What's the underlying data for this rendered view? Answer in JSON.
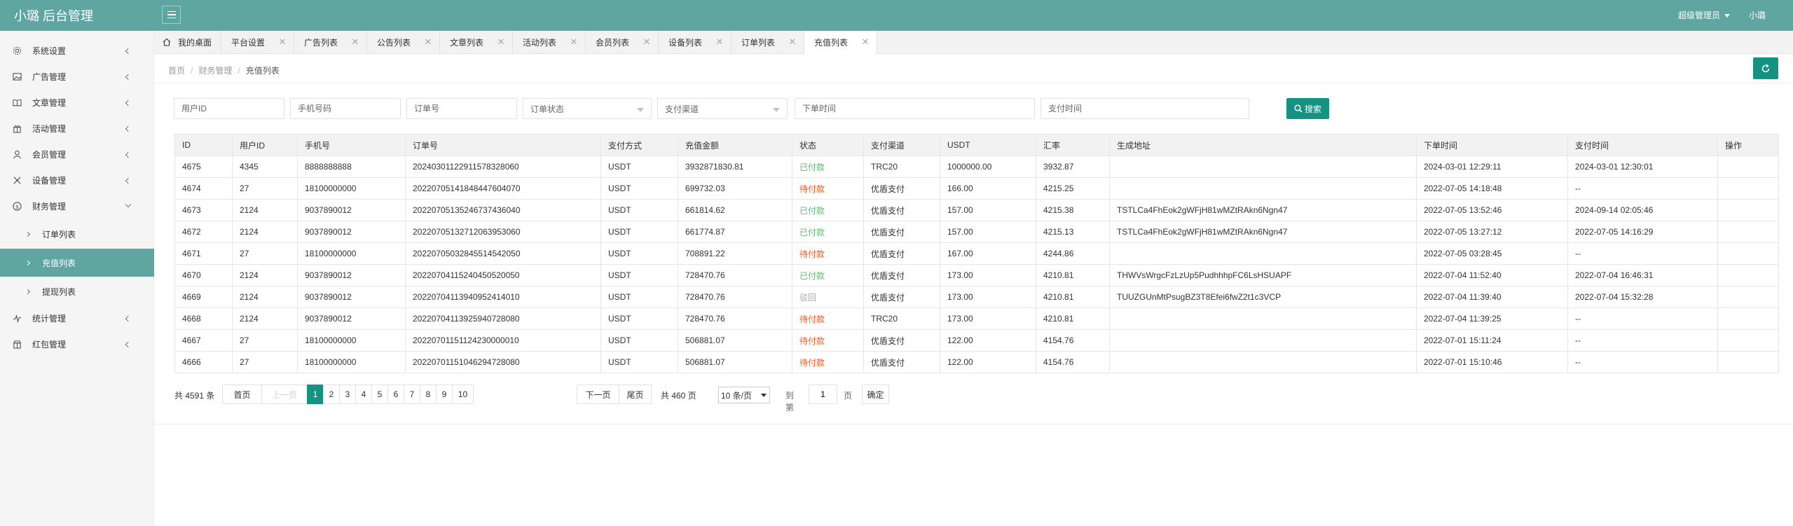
{
  "header": {
    "logo": "小璐 后台管理",
    "role": "超级管理员",
    "user": "小璐"
  },
  "sidebar": {
    "items": [
      {
        "label": "系统设置",
        "icon": "gear-icon"
      },
      {
        "label": "广告管理",
        "icon": "image-icon"
      },
      {
        "label": "文章管理",
        "icon": "book-icon"
      },
      {
        "label": "活动管理",
        "icon": "gift-icon"
      },
      {
        "label": "会员管理",
        "icon": "user-icon"
      },
      {
        "label": "设备管理",
        "icon": "device-icon"
      },
      {
        "label": "财务管理",
        "icon": "money-icon"
      }
    ],
    "finance_sub": [
      {
        "label": "订单列表"
      },
      {
        "label": "充值列表"
      },
      {
        "label": "提现列表"
      }
    ],
    "items_after": [
      {
        "label": "统计管理",
        "icon": "chart-icon"
      },
      {
        "label": "红包管理",
        "icon": "redpacket-icon"
      }
    ]
  },
  "tabs": [
    {
      "label": "我的桌面"
    },
    {
      "label": "平台设置"
    },
    {
      "label": "广告列表"
    },
    {
      "label": "公告列表"
    },
    {
      "label": "文章列表"
    },
    {
      "label": "活动列表"
    },
    {
      "label": "会员列表"
    },
    {
      "label": "设备列表"
    },
    {
      "label": "订单列表"
    },
    {
      "label": "充值列表"
    }
  ],
  "breadcrumb": {
    "home": "首页",
    "section": "财务管理",
    "current": "充值列表"
  },
  "filters": {
    "user_id": "用户ID",
    "phone": "手机号码",
    "order_no": "订单号",
    "order_status": "订单状态",
    "pay_channel": "支付渠道",
    "order_time": "下单时间",
    "pay_time": "支付时间",
    "search": "搜索"
  },
  "table": {
    "headers": [
      "ID",
      "用户ID",
      "手机号",
      "订单号",
      "支付方式",
      "充值金额",
      "状态",
      "支付渠道",
      "USDT",
      "汇率",
      "生成地址",
      "下单时间",
      "支付时间",
      "操作"
    ],
    "rows": [
      [
        "4675",
        "4345",
        "8888888888",
        "202403011229115783280​60",
        "USDT",
        "3932871830.81",
        "已付款",
        "TRC20",
        "1000000.00",
        "3932.87",
        "",
        "2024-03-01 12:29:11",
        "2024-03-01 12:30:01",
        ""
      ],
      [
        "4674",
        "27",
        "18100000000",
        "20220705141848447604070",
        "USDT",
        "699732.03",
        "待付款",
        "优盾支付",
        "166.00",
        "4215.25",
        "",
        "2022-07-05 14:18:48",
        "--",
        ""
      ],
      [
        "4673",
        "2124",
        "9037890012",
        "20220705135246737436040",
        "USDT",
        "661814.62",
        "已付款",
        "优盾支付",
        "157.00",
        "4215.38",
        "TSTLCa4FhEok2gWFjH81wMZtRAkn6Ngn47",
        "2022-07-05 13:52:46",
        "2024-09-14 02:05:46",
        ""
      ],
      [
        "4672",
        "2124",
        "9037890012",
        "20220705132712063953060",
        "USDT",
        "661774.87",
        "已付款",
        "优盾支付",
        "157.00",
        "4215.13",
        "TSTLCa4FhEok2gWFjH81wMZtRAkn6Ngn47",
        "2022-07-05 13:27:12",
        "2022-07-05 14:16:29",
        ""
      ],
      [
        "4671",
        "27",
        "18100000000",
        "20220705032845514542050",
        "USDT",
        "708891.22",
        "待付款",
        "优盾支付",
        "167.00",
        "4244.86",
        "",
        "2022-07-05 03:28:45",
        "--",
        ""
      ],
      [
        "4670",
        "2124",
        "9037890012",
        "20220704115240450520050",
        "USDT",
        "728470.76",
        "已付款",
        "优盾支付",
        "173.00",
        "4210.81",
        "THWVsWrgcFzLzUp5PudhhhpFC6LsHSUAPF",
        "2022-07-04 11:52:40",
        "2022-07-04 16:46:31",
        ""
      ],
      [
        "4669",
        "2124",
        "9037890012",
        "20220704113940952414010",
        "USDT",
        "728470.76",
        "驳回",
        "优盾支付",
        "173.00",
        "4210.81",
        "TUUZGUnMtPsugBZ3T8Efei6fwZ2t1c3VCP",
        "2022-07-04 11:39:40",
        "2022-07-04 15:32:28",
        ""
      ],
      [
        "4668",
        "2124",
        "9037890012",
        "20220704113925940728080",
        "USDT",
        "728470.76",
        "待付款",
        "TRC20",
        "173.00",
        "4210.81",
        "",
        "2022-07-04 11:39:25",
        "--",
        ""
      ],
      [
        "4667",
        "27",
        "18100000000",
        "20220701151124230000010",
        "USDT",
        "506881.07",
        "待付款",
        "优盾支付",
        "122.00",
        "4154.76",
        "",
        "2022-07-01 15:11:24",
        "--",
        ""
      ],
      [
        "4666",
        "27",
        "18100000000",
        "20220701151046294728080",
        "USDT",
        "506881.07",
        "待付款",
        "优盾支付",
        "122.00",
        "4154.76",
        "",
        "2022-07-01 15:10:46",
        "--",
        ""
      ]
    ]
  },
  "status_colors": {
    "已付款": "#5fb878",
    "待付款": "#ff5722",
    "驳回": "#aaaaaa"
  },
  "accent_color": "#149383",
  "header_color": "#5fa6a0",
  "pager": {
    "total": "共 4591 条",
    "first": "首页",
    "prev": "上一页",
    "pages": [
      "1",
      "2",
      "3",
      "4",
      "5",
      "6",
      "7",
      "8",
      "9",
      "10"
    ],
    "current": "1",
    "next": "下一页",
    "last": "尾页",
    "page_count": "共 460 页",
    "limit": "10 条/页",
    "goto_label": "到第",
    "goto_value": "1",
    "page_unit": "页",
    "confirm": "确定"
  }
}
